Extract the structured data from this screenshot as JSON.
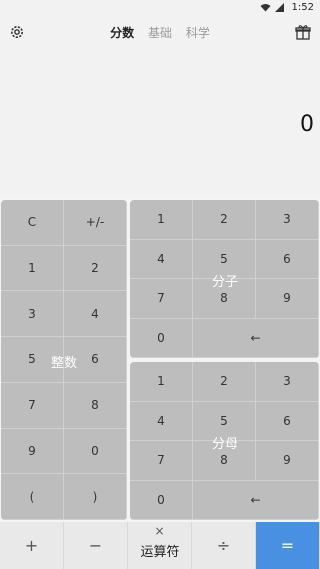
{
  "status": {
    "time": "1:52"
  },
  "tabs": [
    {
      "label": "分数"
    },
    {
      "label": "基础"
    },
    {
      "label": "科学"
    }
  ],
  "display": {
    "value": "0"
  },
  "integer_panel": {
    "label": "整数",
    "keys": [
      "C",
      "+/-",
      "1",
      "2",
      "3",
      "4",
      "5",
      "6",
      "7",
      "8",
      "9",
      "0",
      "(",
      ")"
    ]
  },
  "numerator_panel": {
    "label": "分子",
    "keys": [
      "1",
      "2",
      "3",
      "4",
      "5",
      "6",
      "7",
      "8",
      "9",
      "0",
      "←"
    ]
  },
  "denominator_panel": {
    "label": "分母",
    "keys": [
      "1",
      "2",
      "3",
      "4",
      "5",
      "6",
      "7",
      "8",
      "9",
      "0",
      "←"
    ]
  },
  "operators": {
    "label": "运算符",
    "keys": [
      "+",
      "−",
      "×",
      "÷",
      "="
    ]
  },
  "colors": {
    "accent": "#4a90e2",
    "panel": "#bdbdbd"
  }
}
